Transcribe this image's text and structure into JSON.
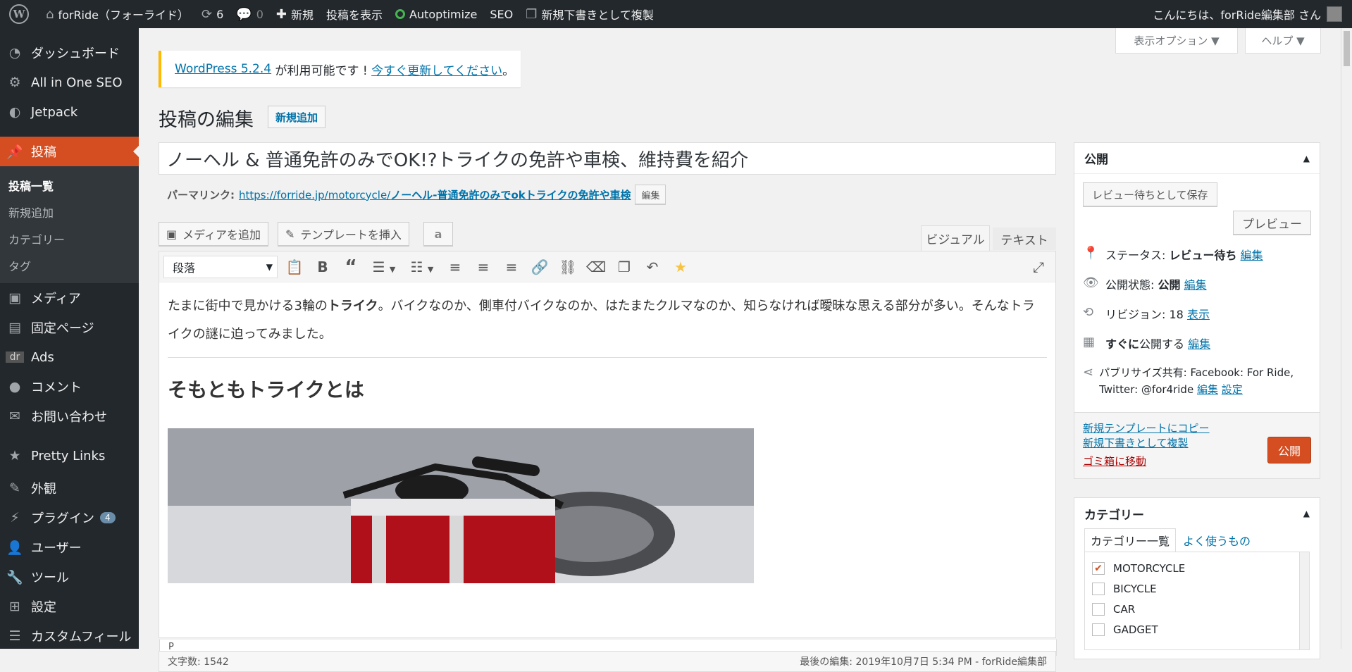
{
  "adminbar": {
    "site_name": "forRide（フォーライド）",
    "updates_count": "6",
    "comments_count": "0",
    "new_label": "新規",
    "view_post": "投稿を表示",
    "autoptimize": "Autoptimize",
    "seo": "SEO",
    "duplicate_draft": "新規下書きとして複製",
    "greeting": "こんにちは、forRide編集部 さん"
  },
  "menu": {
    "items_top": [
      {
        "label": "ダッシュボード",
        "icon": "dashboard-icon"
      },
      {
        "label": "All in One SEO",
        "icon": "gear-icon"
      },
      {
        "label": "Jetpack",
        "icon": "jetpack-icon"
      }
    ],
    "current": {
      "label": "投稿",
      "icon": "pin-icon"
    },
    "submenu": [
      "投稿一覧",
      "新規追加",
      "カテゴリー",
      "タグ"
    ],
    "items_bottom": [
      {
        "label": "メディア",
        "icon": "media-icon"
      },
      {
        "label": "固定ページ",
        "icon": "page-icon"
      },
      {
        "label": "Ads",
        "icon": "ads-icon"
      },
      {
        "label": "コメント",
        "icon": "comment-icon"
      },
      {
        "label": "お問い合わせ",
        "icon": "mail-icon"
      },
      {
        "label": "Pretty Links",
        "icon": "star-icon"
      },
      {
        "label": "外観",
        "icon": "brush-icon"
      },
      {
        "label": "プラグイン",
        "icon": "plugin-icon",
        "badge": "4"
      },
      {
        "label": "ユーザー",
        "icon": "user-icon"
      },
      {
        "label": "ツール",
        "icon": "wrench-icon"
      },
      {
        "label": "設定",
        "icon": "settings-icon"
      },
      {
        "label": "カスタムフィール",
        "icon": "fields-icon"
      }
    ]
  },
  "screen_options": "表示オプション ▼",
  "help": "ヘルプ ▼",
  "notice": {
    "version_link": "WordPress 5.2.4",
    "text": " が利用可能です ! ",
    "update_link": "今すぐ更新してください",
    "end": "。"
  },
  "page_title": "投稿の編集",
  "add_new": "新規追加",
  "post_title": "ノーヘル & 普通免許のみでOK!?トライクの免許や車検、維持費を紹介",
  "permalink": {
    "label": "パーマリンク:",
    "base": "https://forride.jp/motorcycle/",
    "slug": "ノーヘル-普通免許のみでokトライクの免許や車検",
    "edit": "編集"
  },
  "buttons": {
    "add_media": "メディアを追加",
    "insert_template": "テンプレートを挿入",
    "amazon": "a"
  },
  "tabs": {
    "visual": "ビジュアル",
    "text": "テキスト"
  },
  "toolbar": {
    "format": "段落"
  },
  "content": {
    "para_before": "たまに街中で見かける3輪の",
    "para_bold": "トライク",
    "para_after": "。バイクなのか、側車付バイクなのか、はたまたクルマなのか、知らなければ曖昧な思える部分が多い。そんなトライクの謎に迫ってみました。",
    "heading": "そもともトライクとは"
  },
  "path": "P",
  "word_count": "文字数: 1542",
  "last_edit": "最後の編集: 2019年10月7日 5:34 PM - forRide編集部",
  "publish_box": {
    "title": "公開",
    "save_pending": "レビュー待ちとして保存",
    "preview": "プレビュー",
    "status_label": "ステータス: ",
    "status_value": "レビュー待ち",
    "visibility_label": "公開状態: ",
    "visibility_value": "公開",
    "revisions_label": "リビジョン: 18",
    "revisions_link": "表示",
    "schedule_bold": "すぐに",
    "schedule_rest": "公開する",
    "edit": "編集",
    "publicize_label": "パブリサイズ共有: Facebook: For Ride, Twitter: @for4ride",
    "settings": "設定",
    "copy_template": "新規テンプレートにコピー",
    "copy_draft": "新規下書きとして複製",
    "trash": "ゴミ箱に移動",
    "publish": "公開"
  },
  "category_box": {
    "title": "カテゴリー",
    "tab_all": "カテゴリー一覧",
    "tab_popular": "よく使うもの",
    "items": [
      {
        "label": "MOTORCYCLE",
        "checked": true
      },
      {
        "label": "BICYCLE",
        "checked": false
      },
      {
        "label": "CAR",
        "checked": false
      },
      {
        "label": "GADGET",
        "checked": false
      }
    ]
  }
}
